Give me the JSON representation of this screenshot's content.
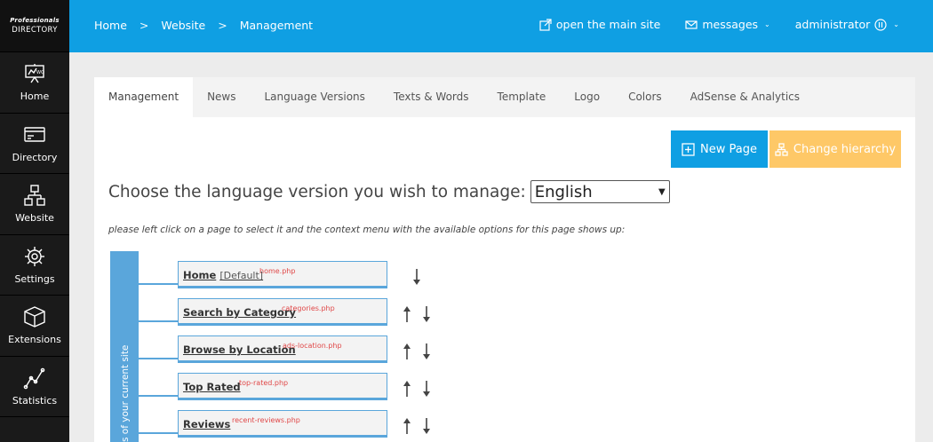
{
  "logo": {
    "line1": "Professionals",
    "line2": "DIRECTORY"
  },
  "sidebar": {
    "items": [
      {
        "label": "Home",
        "icon": "presentation-icon"
      },
      {
        "label": "Directory",
        "icon": "card-icon"
      },
      {
        "label": "Website",
        "icon": "sitemap-icon"
      },
      {
        "label": "Settings",
        "icon": "gear-icon"
      },
      {
        "label": "Extensions",
        "icon": "cube-icon"
      },
      {
        "label": "Statistics",
        "icon": "chart-line-icon"
      }
    ]
  },
  "breadcrumb": {
    "items": [
      "Home",
      "Website",
      "Management"
    ],
    "separator": ">"
  },
  "topbar": {
    "open_site": "open the main site",
    "messages": "messages",
    "user": "administrator"
  },
  "tabs": [
    "Management",
    "News",
    "Language Versions",
    "Texts & Words",
    "Template",
    "Logo",
    "Colors",
    "AdSense & Analytics"
  ],
  "buttons": {
    "new_page": "New Page",
    "change_hierarchy": "Change hierarchy"
  },
  "language": {
    "prompt": "Choose the language version you wish to manage:",
    "selected": "English"
  },
  "hint": "please left click on a page to select it and the context menu with the available options for this page shows up:",
  "tree": {
    "vertical_label": "s of your current site",
    "pages": [
      {
        "name": "Home",
        "default": "[Default]",
        "file": "home.php"
      },
      {
        "name": "Search by Category",
        "default": "",
        "file": "categories.php"
      },
      {
        "name": "Browse by Location",
        "default": "",
        "file": "ads-location.php"
      },
      {
        "name": "Top Rated",
        "default": "",
        "file": "top-rated.php"
      },
      {
        "name": "Reviews",
        "default": "",
        "file": "recent-reviews.php"
      }
    ]
  },
  "colors": {
    "accent": "#0f9fe3",
    "warning": "#fec867",
    "sidebar": "#1a1a1a",
    "tree": "#5aa6db",
    "file": "#e04848"
  }
}
